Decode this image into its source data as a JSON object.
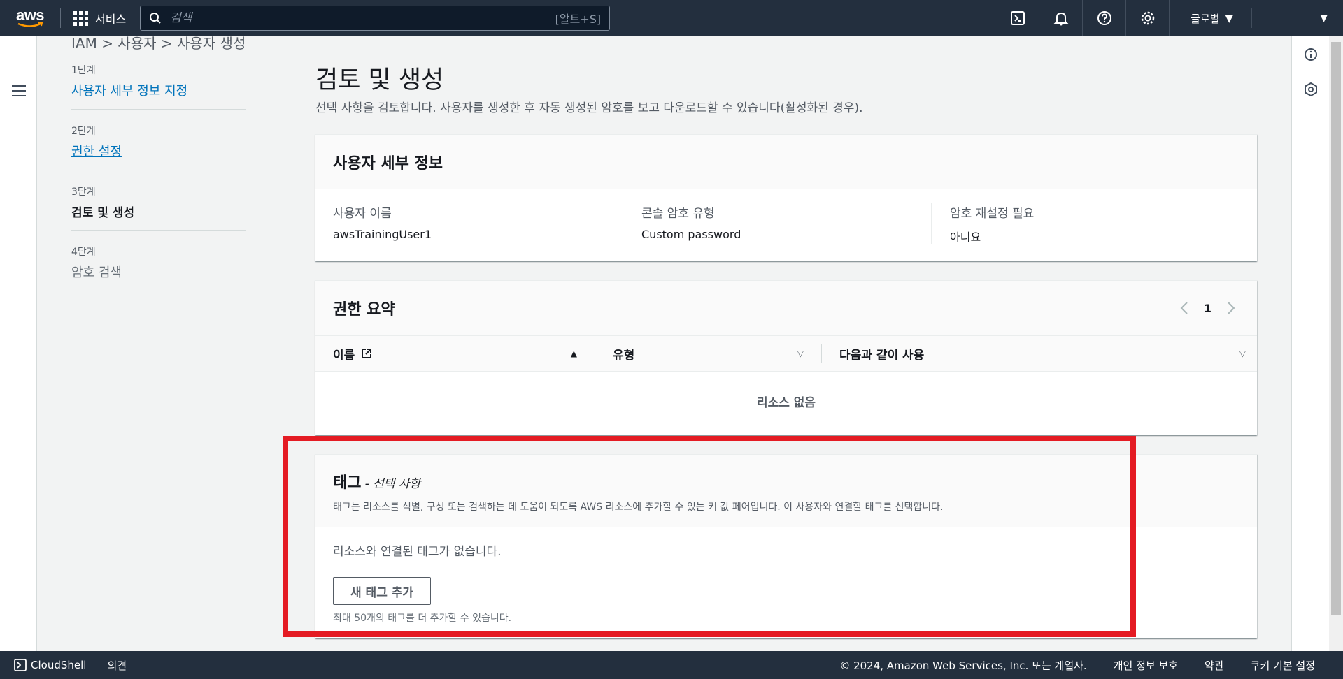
{
  "topnav": {
    "logo": "aws",
    "services_label": "서비스",
    "search_placeholder": "검색",
    "search_shortcut": "[알트+S]",
    "region_label": "글로벌"
  },
  "breadcrumb": {
    "text": "IAM  >  사용자  >  사용자 생성"
  },
  "wizard": {
    "steps": [
      {
        "num": "1단계",
        "label": "사용자 세부 정보 지정"
      },
      {
        "num": "2단계",
        "label": "권한 설정"
      },
      {
        "num": "3단계",
        "label": "검토 및 생성"
      },
      {
        "num": "4단계",
        "label": "암호 검색"
      }
    ]
  },
  "main": {
    "title": "검토 및 생성",
    "description": "선택 사항을 검토합니다. 사용자를 생성한 후 자동 생성된 암호를 보고 다운로드할 수 있습니다(활성화된 경우)."
  },
  "user_details": {
    "title": "사용자 세부 정보",
    "fields": [
      {
        "label": "사용자 이름",
        "value": "awsTrainingUser1"
      },
      {
        "label": "콘솔 암호 유형",
        "value": "Custom password"
      },
      {
        "label": "암호 재설정 필요",
        "value": "아니요"
      }
    ]
  },
  "permissions": {
    "title": "권한 요약",
    "page": "1",
    "columns": [
      "이름",
      "유형",
      "다음과 같이 사용"
    ],
    "empty": "리소스 없음"
  },
  "tags": {
    "title": "태그",
    "optional": "- 선택 사항",
    "description": "태그는 리소스를 식별, 구성 또는 검색하는 데 도움이 되도록 AWS 리소스에 추가할 수 있는 키 값 페어입니다. 이 사용자와 연결할 태그를 선택합니다.",
    "no_tags": "리소스와 연결된 태그가 없습니다.",
    "add_button": "새 태그 추가",
    "hint": "최대 50개의 태그를 더 추가할 수 있습니다."
  },
  "footer": {
    "cloudshell": "CloudShell",
    "feedback": "의견",
    "copyright": "© 2024, Amazon Web Services, Inc. 또는 계열사.",
    "privacy": "개인 정보 보호",
    "terms": "약관",
    "cookies": "쿠키 기본 설정"
  },
  "colors": {
    "nav_bg": "#232f3e",
    "link": "#0073bb",
    "highlight": "#e41b23"
  }
}
